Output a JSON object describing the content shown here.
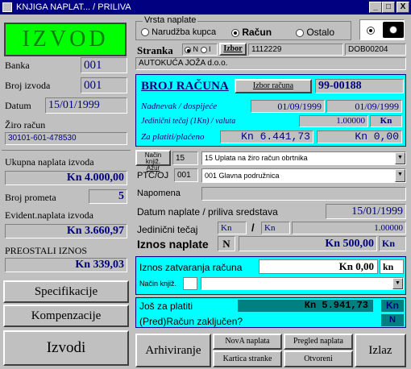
{
  "window": {
    "title": "KNJIGA NAPLAT... / PRILIVA",
    "min": "_",
    "max": "□",
    "close": "X"
  },
  "left": {
    "header": "IZVOD",
    "banka_label": "Banka",
    "banka_value": "001",
    "broj_izvoda_label": "Broj izvoda",
    "broj_izvoda_value": "001",
    "datum_label": "Datum",
    "datum_value": "15/01/1999",
    "ziro_label": "Žiro račun",
    "ziro_value": "30101-601-478530",
    "ukupna_label": "Ukupna naplata izvoda",
    "ukupna_value": "Kn 4.000,00",
    "broj_prometa_label": "Broj prometa",
    "broj_prometa_value": "5",
    "evident_label": "Evident.naplata izvoda",
    "evident_value": "Kn 3.660,97",
    "preostali_label": "PREOSTALI IZNOS",
    "preostali_value": "Kn 339,03",
    "specifikacije": "Specifikacije",
    "kompenzacije": "Kompenzacije",
    "izvodi": "Izvodi"
  },
  "vrsta": {
    "title": "Vrsta naplate",
    "options": [
      "Narudžba kupca",
      "Račun",
      "Ostalo"
    ],
    "selected": "Račun"
  },
  "stranka": {
    "label": "Stranka",
    "opt_n": "N",
    "opt_i": "I",
    "izbor": "Izbor",
    "code": "1112229",
    "doc": "DOB00204",
    "name": "AUTOKUĆA JOŽA d.o.o."
  },
  "racun": {
    "title": "BROJ RAČUNA",
    "izbor_btn": "Izbor računa",
    "number": "99-00188",
    "nadnevak_label": "Nadnevak / dospijeće",
    "nadnevak": "01/09/1999",
    "dospijece": "01/09/1999",
    "tecaj_label": "Jedinični tečaj (1Kn) / valuta",
    "tecaj": "1.00000",
    "valuta": "Kn",
    "platiti_label": "Za platiti/plaćeno",
    "platiti": "Kn 6.441,73",
    "placeno": "Kn 0,00"
  },
  "nacin": {
    "label1": "Način knjiž.",
    "label2": "Ažur",
    "num": "15",
    "value": "15 Uplata na žiro račun obrtnika"
  },
  "ptc": {
    "label": "PTC/OJ",
    "code": "001",
    "value": "001 Glavna podružnica"
  },
  "napomena_label": "Napomena",
  "datum_naplate": {
    "label": "Datum naplate / priliva sredstava",
    "value": "15/01/1999"
  },
  "jed_tecaj": {
    "label": "Jedinični tečaj",
    "cur1": "Kn",
    "sep": "/",
    "cur2": "Kn",
    "value": "1.00000"
  },
  "iznos_naplate": {
    "label": "Iznos naplate",
    "flag": "N",
    "value": "Kn 500,00",
    "cur": "Kn"
  },
  "zatvaranje": {
    "label": "Iznos zatvaranja računa",
    "value": "Kn 0,00",
    "cur": "kn",
    "nacin_label": "Način knjiž."
  },
  "jos": {
    "label": "Još za platiti",
    "value": "Kn 5.941,73",
    "cur": "Kn",
    "zak_label": "(Pred)Račun zaključen?",
    "zak_value": "N"
  },
  "buttons": {
    "arhiviranje": "Arhiviranje",
    "nova": "NovA naplata",
    "pregled": "Pregled naplata",
    "kartica": "Kartica stranke",
    "otvoreni": "Otvoreni",
    "izlaz": "Izlaz"
  },
  "colors": {
    "cyan": "#00ffff",
    "green": "#00ff00",
    "navy": "#000080",
    "teal": "#008080"
  }
}
